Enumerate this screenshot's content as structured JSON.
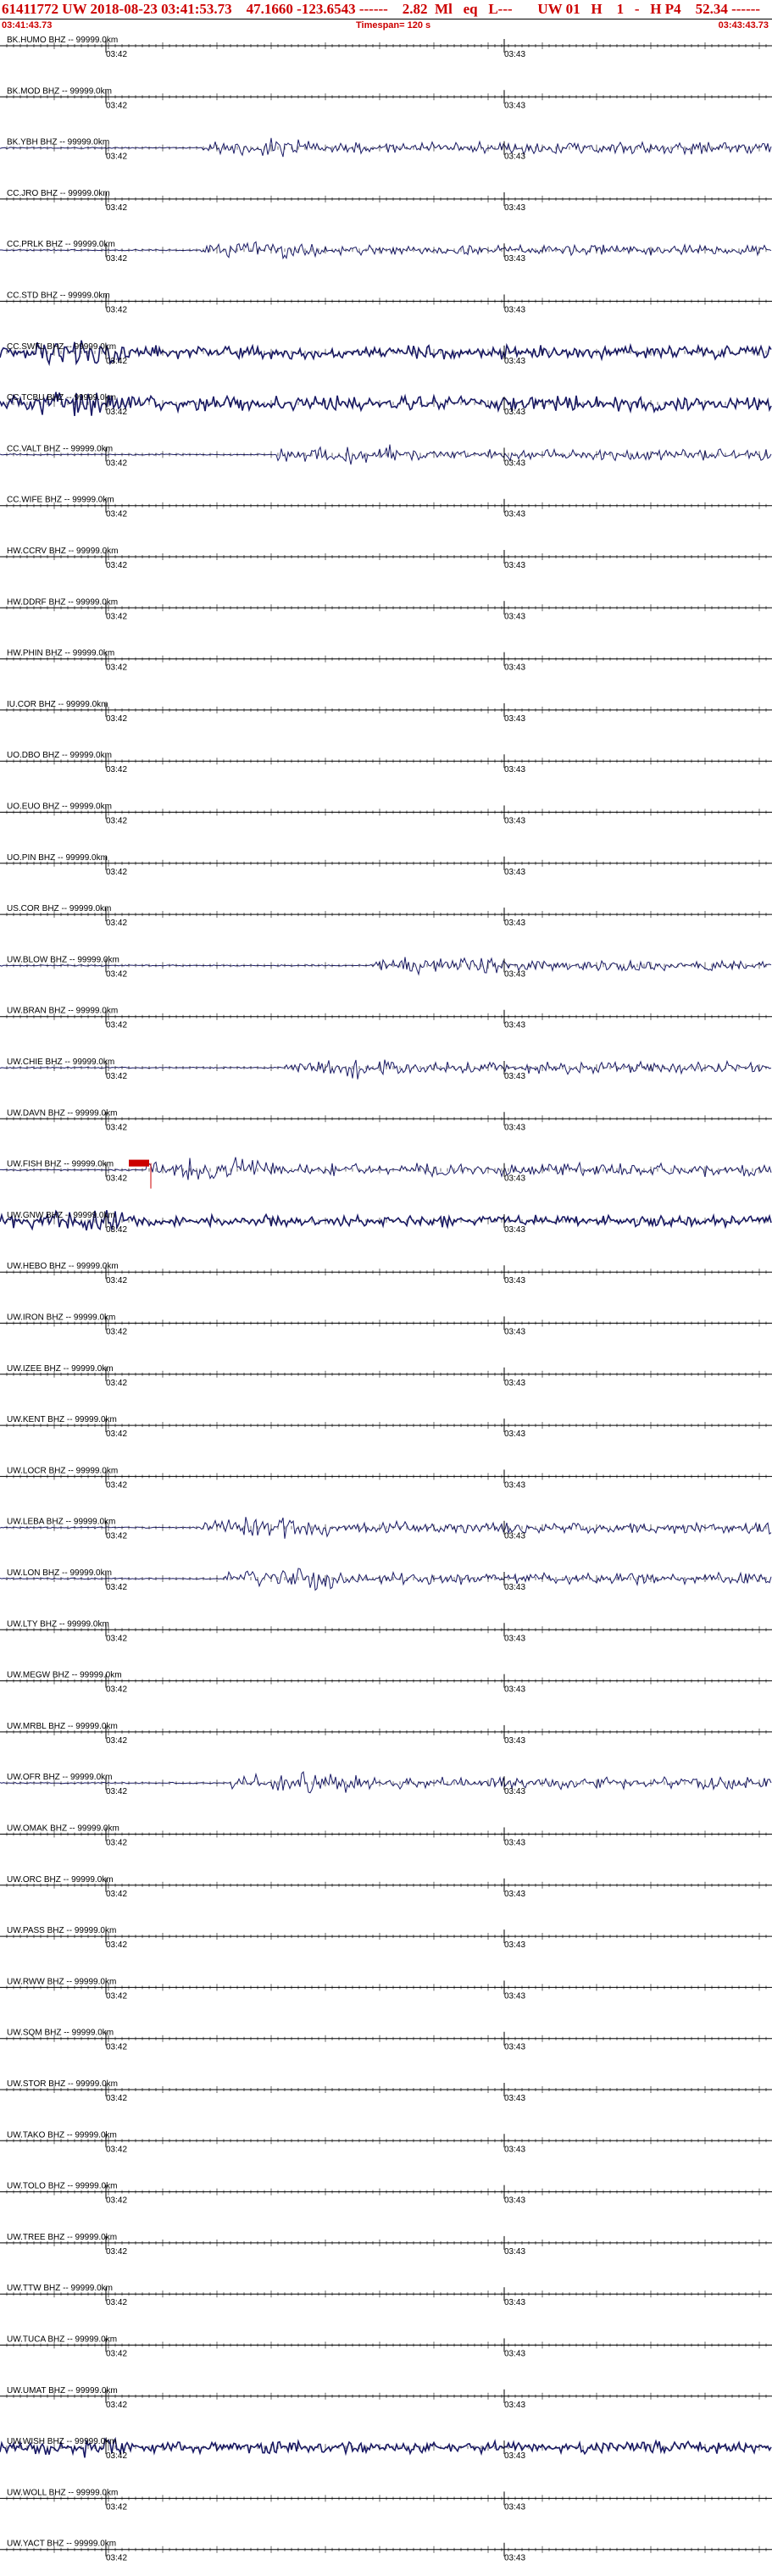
{
  "header": {
    "title": "61411772 UW 2018-08-23 03:41:53.73    47.1660 -123.6543 ------    2.82  Ml   eq   L---       UW 01   H    1   -   H P4    52.34 ------",
    "start_time": "03:41:43.73",
    "timespan": "Timespan= 120 s",
    "end_time": "03:43:43.73"
  },
  "tick_labels": {
    "first": "03:42",
    "second": "03:43"
  },
  "pick": {
    "station": "UW.FISH BHZ",
    "color": "#cc0000"
  },
  "colors": {
    "trace": "#1a1a66",
    "grid": "#000000",
    "pick": "#cc0000"
  },
  "stations": [
    {
      "label": "BK.HUMO BHZ -- 99999.0km",
      "amp": 0,
      "onset": 1
    },
    {
      "label": "BK.MOD BHZ -- 99999.0km",
      "amp": 0,
      "onset": 1
    },
    {
      "label": "BK.YBH BHZ -- 99999.0km",
      "amp": 14,
      "onset": 0.26
    },
    {
      "label": "CC.JRO BHZ -- 99999.0km",
      "amp": 0,
      "onset": 1
    },
    {
      "label": "CC.PRLK BHZ -- 99999.0km",
      "amp": 12,
      "onset": 0.26
    },
    {
      "label": "CC.STD BHZ -- 99999.0km",
      "amp": 0,
      "onset": 1
    },
    {
      "label": "CC.SWFL BHZ -- 99999.0km",
      "amp": 16,
      "onset": 0.0
    },
    {
      "label": "CC.TCBU BHZ -- 99999.0km",
      "amp": 18,
      "onset": 0.0
    },
    {
      "label": "CC.VALT BHZ -- 99999.0km",
      "amp": 14,
      "onset": 0.36
    },
    {
      "label": "CC.WIFE BHZ -- 99999.0km",
      "amp": 0,
      "onset": 1
    },
    {
      "label": "HW.CCRV BHZ -- 99999.0km",
      "amp": 0,
      "onset": 1
    },
    {
      "label": "HW.DDRF BHZ -- 99999.0km",
      "amp": 0,
      "onset": 1
    },
    {
      "label": "HW.PHIN BHZ -- 99999.0km",
      "amp": 0,
      "onset": 1
    },
    {
      "label": "IU.COR BHZ -- 99999.0km",
      "amp": 0,
      "onset": 1
    },
    {
      "label": "UO.DBO BHZ -- 99999.0km",
      "amp": 0,
      "onset": 1
    },
    {
      "label": "UO.EUO BHZ -- 99999.0km",
      "amp": 0,
      "onset": 1
    },
    {
      "label": "UO.PIN BHZ -- 99999.0km",
      "amp": 0,
      "onset": 1
    },
    {
      "label": "US.COR BHZ -- 99999.0km",
      "amp": 0,
      "onset": 1
    },
    {
      "label": "UW.BLOW BHZ -- 99999.0km",
      "amp": 12,
      "onset": 0.48
    },
    {
      "label": "UW.BRAN BHZ -- 99999.0km",
      "amp": 0,
      "onset": 1
    },
    {
      "label": "UW.CHIE BHZ -- 99999.0km",
      "amp": 14,
      "onset": 0.37
    },
    {
      "label": "UW.DAVN BHZ -- 99999.0km",
      "amp": 0,
      "onset": 1
    },
    {
      "label": "UW.FISH BHZ -- 99999.0km",
      "amp": 16,
      "onset": 0.19
    },
    {
      "label": "UW.GNW BHZ -- 99999.0km",
      "amp": 14,
      "onset": 0.0
    },
    {
      "label": "UW.HEBO BHZ -- 99999.0km",
      "amp": 0,
      "onset": 1
    },
    {
      "label": "UW.IRON BHZ -- 99999.0km",
      "amp": 0,
      "onset": 1
    },
    {
      "label": "UW.IZEE BHZ -- 99999.0km",
      "amp": 0,
      "onset": 1
    },
    {
      "label": "UW.KENT BHZ -- 99999.0km",
      "amp": 0,
      "onset": 1
    },
    {
      "label": "UW.LOCR BHZ -- 99999.0km",
      "amp": 0,
      "onset": 1
    },
    {
      "label": "UW.LEBA BHZ -- 99999.0km",
      "amp": 14,
      "onset": 0.26
    },
    {
      "label": "UW.LON BHZ -- 99999.0km",
      "amp": 14,
      "onset": 0.29
    },
    {
      "label": "UW.LTY BHZ -- 99999.0km",
      "amp": 0,
      "onset": 1
    },
    {
      "label": "UW.MEGW BHZ -- 99999.0km",
      "amp": 0,
      "onset": 1
    },
    {
      "label": "UW.MRBL BHZ -- 99999.0km",
      "amp": 0,
      "onset": 1
    },
    {
      "label": "UW.OFR BHZ -- 99999.0km",
      "amp": 14,
      "onset": 0.3
    },
    {
      "label": "UW.OMAK BHZ -- 99999.0km",
      "amp": 0,
      "onset": 1
    },
    {
      "label": "UW.ORC BHZ -- 99999.0km",
      "amp": 0,
      "onset": 1
    },
    {
      "label": "UW.PASS BHZ -- 99999.0km",
      "amp": 0,
      "onset": 1
    },
    {
      "label": "UW.RWW BHZ -- 99999.0km",
      "amp": 0,
      "onset": 1
    },
    {
      "label": "UW.SQM BHZ -- 99999.0km",
      "amp": 0,
      "onset": 1
    },
    {
      "label": "UW.STOR BHZ -- 99999.0km",
      "amp": 0,
      "onset": 1
    },
    {
      "label": "UW.TAKO BHZ -- 99999.0km",
      "amp": 0,
      "onset": 1
    },
    {
      "label": "UW.TOLO BHZ -- 99999.0km",
      "amp": 0,
      "onset": 1
    },
    {
      "label": "UW.TREE BHZ -- 99999.0km",
      "amp": 0,
      "onset": 1
    },
    {
      "label": "UW.TTW BHZ -- 99999.0km",
      "amp": 0,
      "onset": 1
    },
    {
      "label": "UW.TUCA BHZ -- 99999.0km",
      "amp": 0,
      "onset": 1
    },
    {
      "label": "UW.UMAT BHZ -- 99999.0km",
      "amp": 0,
      "onset": 1
    },
    {
      "label": "UW.WISH BHZ -- 99999.0km",
      "amp": 14,
      "onset": 0.0
    },
    {
      "label": "UW.WOLL BHZ -- 99999.0km",
      "amp": 0,
      "onset": 1
    },
    {
      "label": "UW.YACT BHZ -- 99999.0km",
      "amp": 0,
      "onset": 1
    }
  ]
}
